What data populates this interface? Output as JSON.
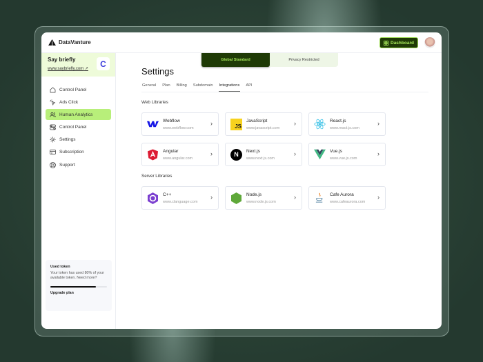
{
  "app": {
    "name": "DataVanture",
    "dashboard_label": "Dashboard"
  },
  "brand": {
    "name": "Say briefly",
    "url": "www.saybriefly.com",
    "logo_letter": "C"
  },
  "sidebar": {
    "items": [
      {
        "label": "Control Panel",
        "icon": "home-icon"
      },
      {
        "label": "Ads Click",
        "icon": "click-icon"
      },
      {
        "label": "Human Analytics",
        "icon": "users-icon",
        "active": true
      },
      {
        "label": "Control Panel",
        "icon": "toggle-icon"
      },
      {
        "label": "Settings",
        "icon": "gear-icon"
      },
      {
        "label": "Subscription",
        "icon": "card-icon"
      },
      {
        "label": "Support",
        "icon": "support-icon"
      }
    ]
  },
  "token": {
    "title": "Used token",
    "text": "Your token has used 80% of your available token. Need more?",
    "used_percent": 80,
    "upgrade_label": "Upgrade plan"
  },
  "toggle": {
    "options": [
      "Global Standard",
      "Privacy Restricted"
    ],
    "selected": "Global Standard"
  },
  "page": {
    "title": "Settings",
    "tabs": [
      "General",
      "Plan",
      "Billing",
      "Subdomain",
      "Integrations",
      "API"
    ],
    "active_tab": "Integrations"
  },
  "sections": [
    {
      "title": "Web Libraries",
      "items": [
        {
          "name": "Webflow",
          "url": "www.webflow.com"
        },
        {
          "name": "JavaScript",
          "url": "www.javascript.com"
        },
        {
          "name": "React.js",
          "url": "www.react.js.com"
        },
        {
          "name": "Angular",
          "url": "www.angular.com"
        },
        {
          "name": "Next.js",
          "url": "www.next.js.com"
        },
        {
          "name": "Vue.js",
          "url": "www.vue.js.com"
        }
      ]
    },
    {
      "title": "Server Libraries",
      "items": [
        {
          "name": "C++",
          "url": "www.clanguage.com"
        },
        {
          "name": "Node.js",
          "url": "www.node.js.com"
        },
        {
          "name": "Cafe Aurora",
          "url": "www.cafeaurora.com"
        }
      ]
    }
  ],
  "colors": {
    "accent": "#b8ef7a",
    "dark_green": "#1f3a06",
    "lime_text": "#a6e85a",
    "brand_bg": "#eefbd9"
  }
}
